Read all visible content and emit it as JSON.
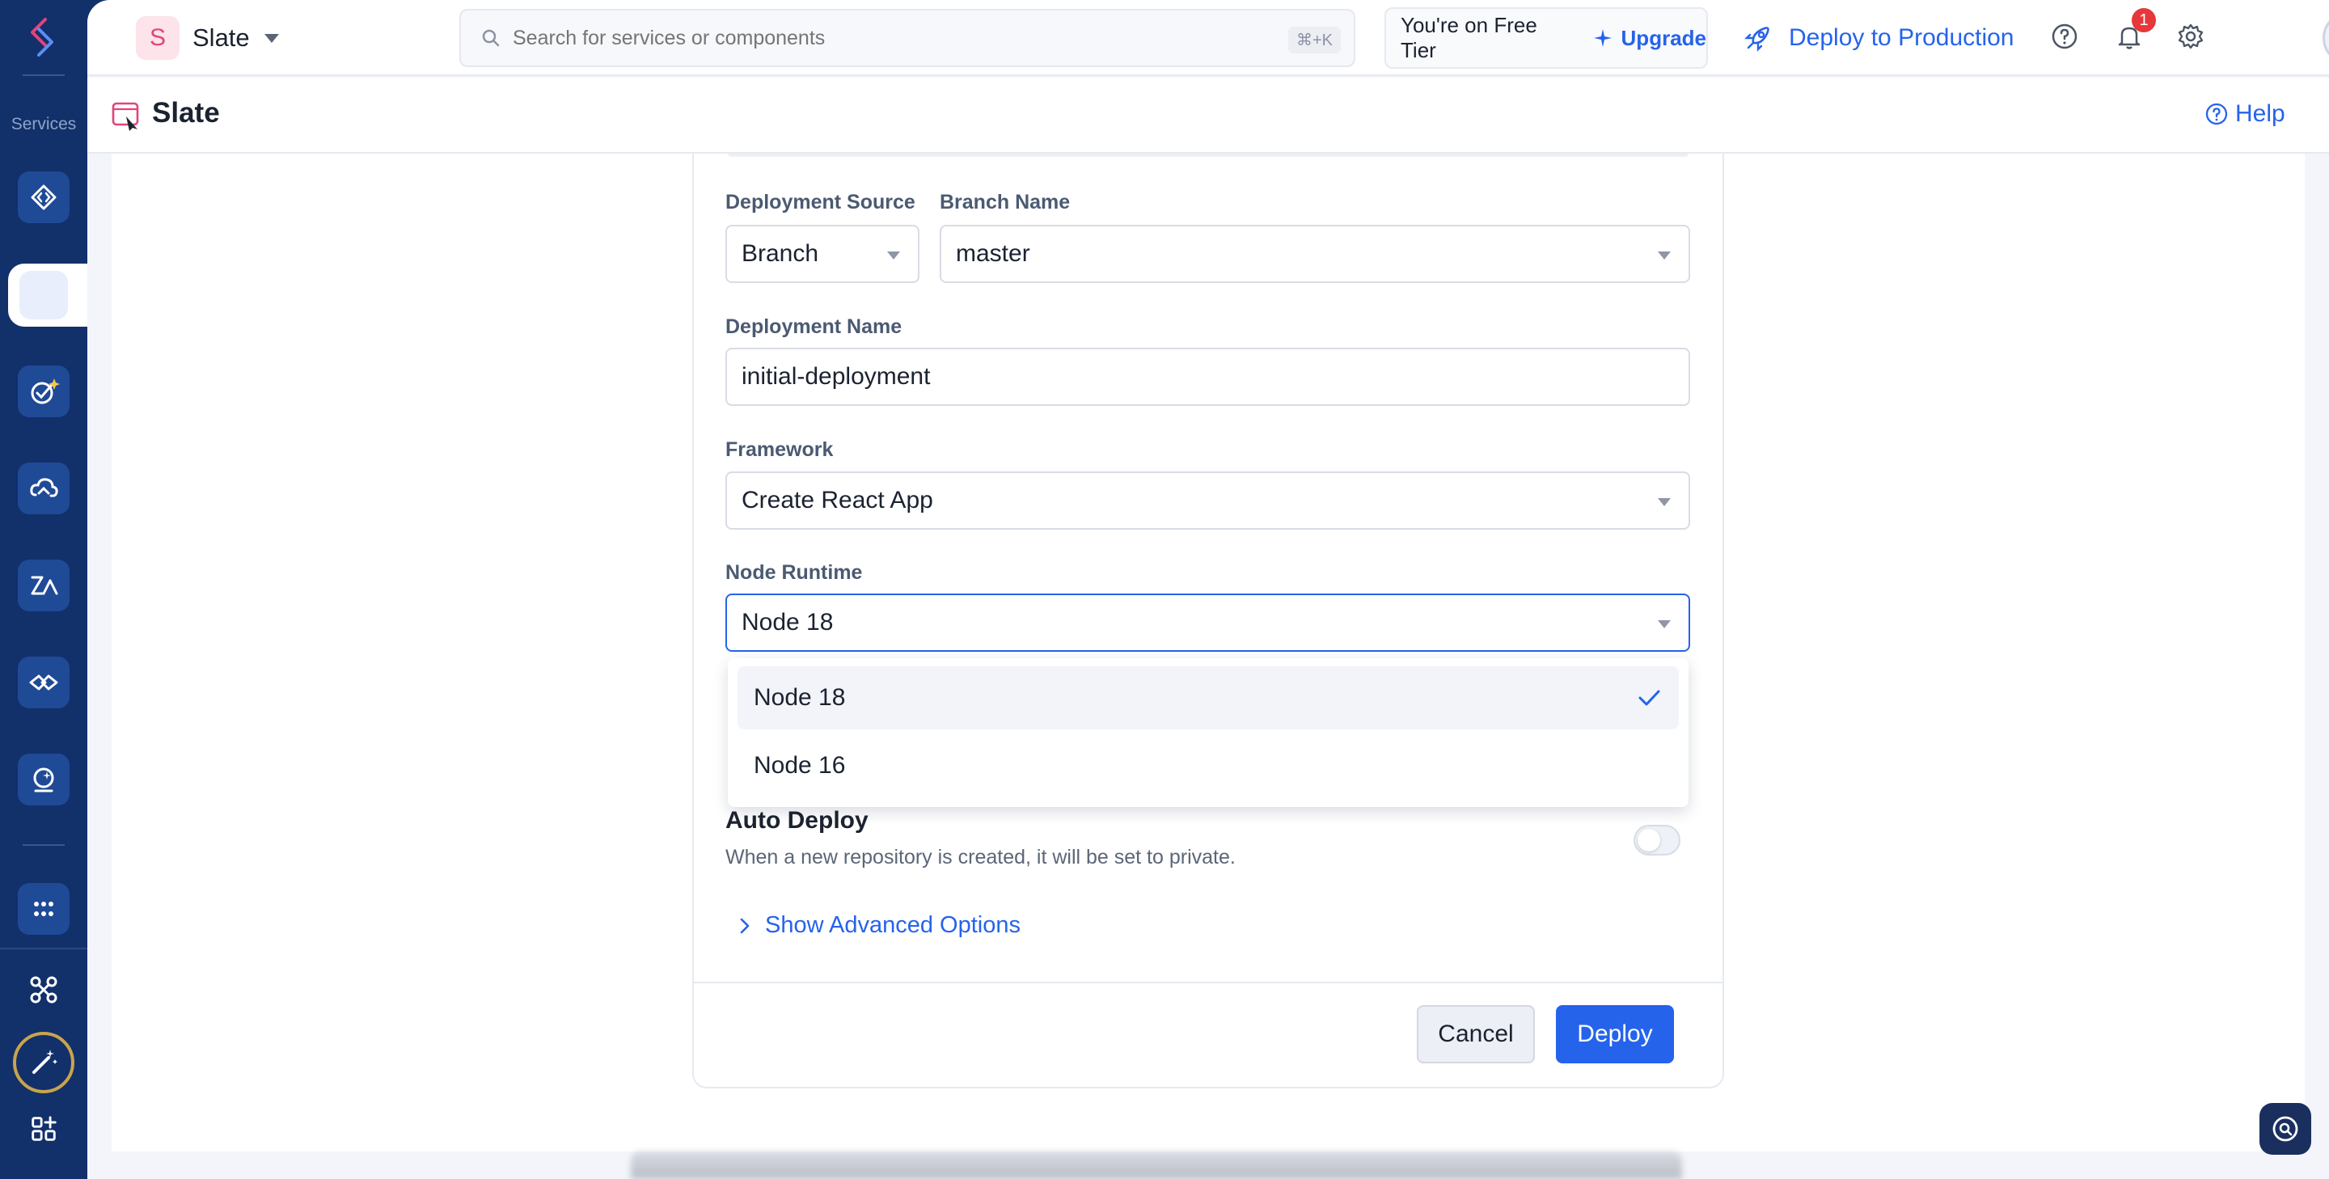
{
  "sidebar": {
    "services_label": "Services",
    "items": [
      {
        "icon": "api-gateway-icon"
      },
      {
        "icon": "slate-icon"
      },
      {
        "icon": "checklist-ai-icon"
      },
      {
        "icon": "cloud-scale-icon"
      },
      {
        "icon": "quick-ml-icon"
      },
      {
        "icon": "integrations-icon"
      },
      {
        "icon": "signals-icon"
      },
      {
        "icon": "all-services-icon"
      },
      {
        "icon": "workflow-icon"
      },
      {
        "icon": "magic-wand-icon"
      },
      {
        "icon": "apps-grid-icon"
      }
    ]
  },
  "topbar": {
    "app_initial": "S",
    "app_name": "Slate",
    "search_placeholder": "Search for services or components",
    "search_shortcut": "⌘+K",
    "tier_text": "You're on Free Tier",
    "upgrade_label": "Upgrade",
    "deploy_label": "Deploy to Production",
    "notification_count": "1"
  },
  "subheader": {
    "title": "Slate",
    "help_label": "Help"
  },
  "form": {
    "deployment_source_label": "Deployment Source",
    "deployment_source_value": "Branch",
    "branch_name_label": "Branch Name",
    "branch_name_value": "master",
    "deployment_name_label": "Deployment Name",
    "deployment_name_value": "initial-deployment",
    "framework_label": "Framework",
    "framework_value": "Create React App",
    "node_runtime_label": "Node Runtime",
    "node_runtime_value": "Node 18",
    "node_runtime_options": [
      "Node 18",
      "Node 16"
    ],
    "auto_deploy_title": "Auto Deploy",
    "auto_deploy_desc": "When a new repository is created, it will be set to private.",
    "advanced_label": "Show Advanced Options",
    "cancel_label": "Cancel",
    "deploy_label": "Deploy"
  },
  "colors": {
    "sidebar_bg": "#12306a",
    "accent": "#2563eb",
    "app_badge": "#e2457a",
    "notification": "#e5383b"
  }
}
